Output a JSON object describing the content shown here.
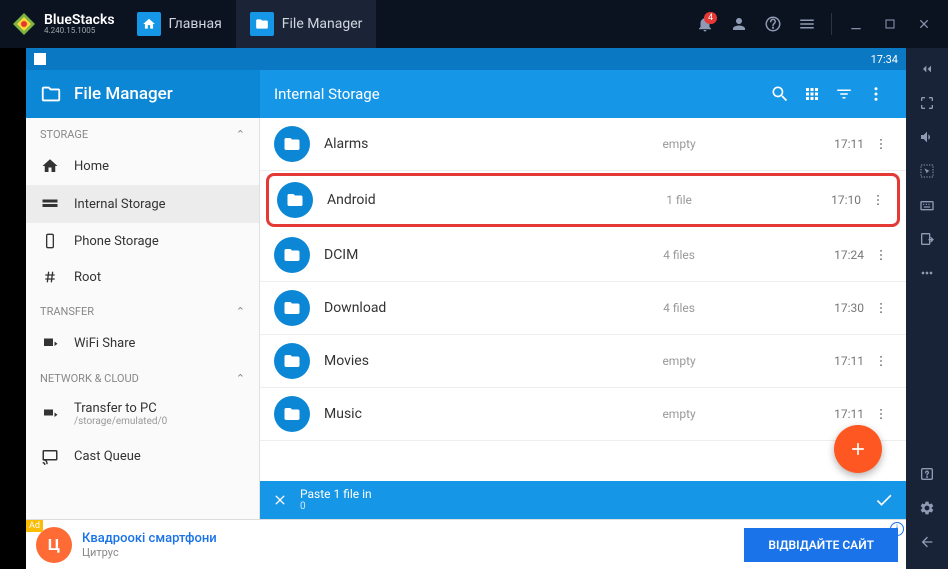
{
  "brand": {
    "name": "BlueStacks",
    "version": "4.240.15.1005"
  },
  "tabs": [
    {
      "label": "Главная",
      "icon": "home"
    },
    {
      "label": "File Manager",
      "icon": "folder"
    }
  ],
  "notif_count": "4",
  "status": {
    "time": "17:34"
  },
  "app": {
    "title": "File Manager",
    "breadcrumb": "Internal Storage"
  },
  "sidebar": {
    "sections": [
      {
        "title": "STORAGE",
        "items": [
          {
            "icon": "home",
            "label": "Home"
          },
          {
            "icon": "storage",
            "label": "Internal Storage",
            "active": true
          },
          {
            "icon": "phone",
            "label": "Phone Storage"
          },
          {
            "icon": "root",
            "label": "Root"
          }
        ]
      },
      {
        "title": "TRANSFER",
        "items": [
          {
            "icon": "wifi",
            "label": "WiFi Share"
          }
        ]
      },
      {
        "title": "NETWORK & CLOUD",
        "items": [
          {
            "icon": "pc",
            "label": "Transfer to PC",
            "sub": "/storage/emulated/0"
          },
          {
            "icon": "cast",
            "label": "Cast Queue"
          }
        ]
      }
    ]
  },
  "files": [
    {
      "name": "Alarms",
      "meta": "empty",
      "time": "17:11",
      "highlight": false
    },
    {
      "name": "Android",
      "meta": "1 file",
      "time": "17:10",
      "highlight": true
    },
    {
      "name": "DCIM",
      "meta": "4 files",
      "time": "17:24",
      "highlight": false
    },
    {
      "name": "Download",
      "meta": "4 files",
      "time": "17:30",
      "highlight": false
    },
    {
      "name": "Movies",
      "meta": "empty",
      "time": "17:11",
      "highlight": false
    },
    {
      "name": "Music",
      "meta": "empty",
      "time": "17:11",
      "highlight": false
    }
  ],
  "paste": {
    "text": "Paste 1 file in",
    "sub": "0"
  },
  "ad": {
    "title": "Квадроокі смартфони",
    "sub": "Цитрус",
    "button": "ВІДВІДАЙТЕ САЙТ"
  }
}
